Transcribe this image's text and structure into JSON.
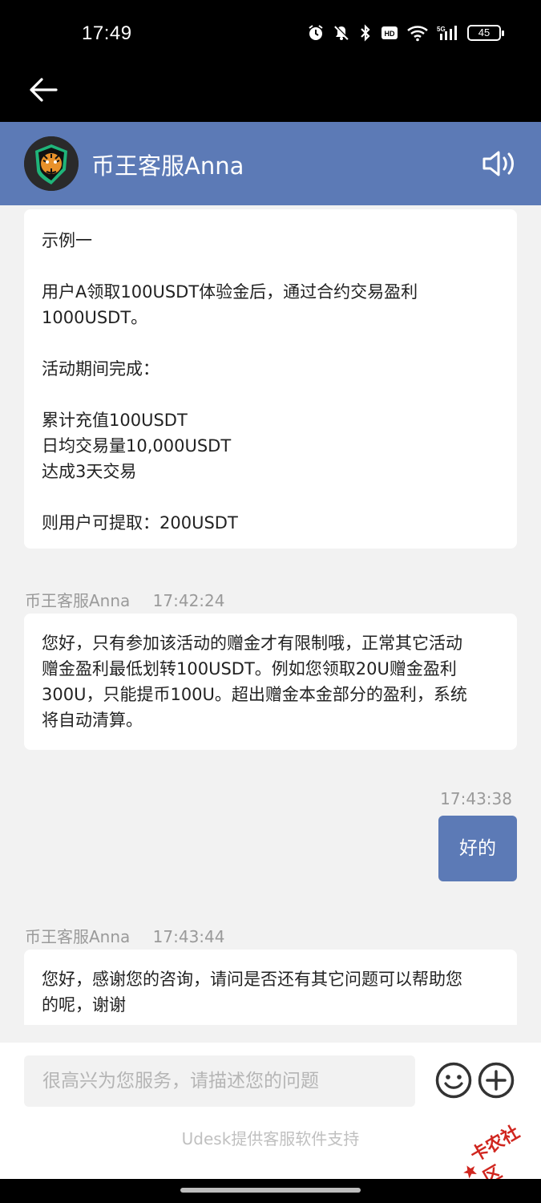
{
  "status": {
    "time": "17:49",
    "battery": "45"
  },
  "header": {
    "title": "币王客服Anna"
  },
  "messages": {
    "msg1": {
      "text": "示例一\n\n用户A领取100USDT体验金后，通过合约交易盈利\n1000USDT。\n\n活动期间完成：\n\n累计充值100USDT\n日均交易量10,000USDT\n达成3天交易\n\n则用户可提取：200USDT"
    },
    "msg2": {
      "sender": "币王客服Anna",
      "time": "17:42:24",
      "text": "您好，只有参加该活动的赠金才有限制哦，正常其它活动\n赠金盈利最低划转100USDT。例如您领取20U赠金盈利\n300U，只能提币100U。超出赠金本金部分的盈利，系统\n将自动清算。"
    },
    "msg3": {
      "time": "17:43:38",
      "text": "好的"
    },
    "msg4": {
      "sender": "币王客服Anna",
      "time": "17:43:44",
      "text": "您好，感谢您的咨询，请问是否还有其它问题可以帮助您\n的呢，谢谢"
    }
  },
  "input": {
    "placeholder": "很高兴为您服务，请描述您的问题"
  },
  "footer": {
    "powered_by": "Udesk提供客服软件支持"
  },
  "watermark": {
    "text": "卡农社区"
  },
  "colors": {
    "accent": "#5c7ab6",
    "background": "#f2f2f2"
  },
  "icons": [
    "back-arrow-icon",
    "speaker-icon",
    "emoji-icon",
    "plus-icon",
    "alarm-icon",
    "mute-icon",
    "bluetooth-icon",
    "hd-icon",
    "wifi-icon",
    "signal-icon",
    "battery-icon"
  ]
}
